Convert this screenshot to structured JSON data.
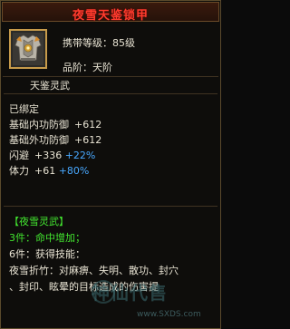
{
  "title": "夜雪天鉴锁甲",
  "header": {
    "level_line": "携带等级：85级",
    "rank_line": "品阶：天阶"
  },
  "item_name": "天鉴灵武",
  "bound": "已绑定",
  "stats": [
    {
      "label": "基础内功防御",
      "value": "+612",
      "bonus": ""
    },
    {
      "label": "基础外功防御",
      "value": "+612",
      "bonus": ""
    },
    {
      "label": "闪避",
      "value": "+336",
      "bonus": "+22%"
    },
    {
      "label": "体力",
      "value": "+61",
      "bonus": "+80%"
    }
  ],
  "set": {
    "title": "【夜雪灵武】",
    "piece3": "3件：命中增加；",
    "piece6": "6件：获得技能：",
    "skill_line1": "夜雪折竹：对麻痹、失明、散功、封穴",
    "skill_line2": "、封印、眩晕的目标造成的伤害提"
  },
  "watermark": "神仙代售",
  "watermark_url": "www.SXDS.com",
  "colors": {
    "title": "#ff3c2e",
    "text": "#e8e3d3",
    "bonus": "#48a8ff",
    "set": "#42e52f",
    "frame": "#c79b4b"
  },
  "icon": "armor-icon"
}
